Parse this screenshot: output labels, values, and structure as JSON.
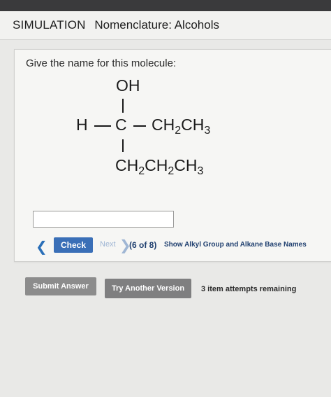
{
  "header": {
    "simulation_label": "SIMULATION",
    "topic": "Nomenclature: Alcohols"
  },
  "question": {
    "prompt": "Give the name for this molecule:",
    "molecule": {
      "top_group": "OH",
      "left_atom": "H",
      "center_atom": "C",
      "right_group": "CH2CH3",
      "bottom_group": "CH2CH2CH3"
    },
    "answer_value": "",
    "answer_placeholder": ""
  },
  "navigation": {
    "check_label": "Check",
    "next_label": "Next",
    "progress": "(6 of 8)",
    "show_names_label": "Show Alkyl Group and Alkane Base Names"
  },
  "actions": {
    "submit_label": "Submit Answer",
    "try_another_label": "Try Another Version",
    "attempts_text": "3 item attempts remaining"
  },
  "colors": {
    "check_button": "#3a6fb7",
    "link_text": "#1f3f6f",
    "disabled_next": "#9fb6d4",
    "gray_button": "#8c8c8c"
  }
}
